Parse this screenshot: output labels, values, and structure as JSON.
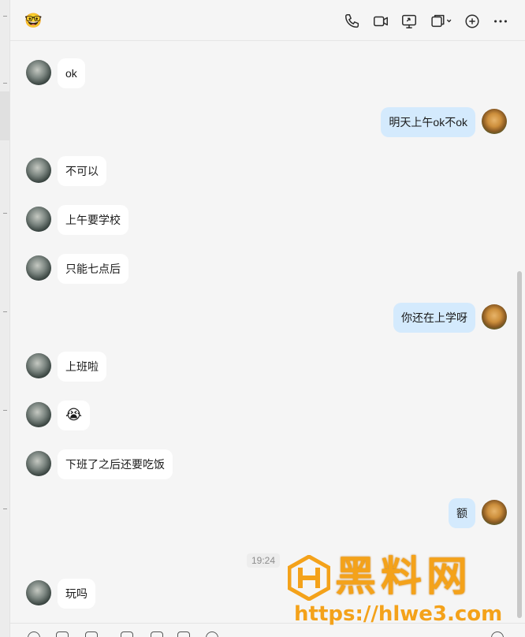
{
  "header": {
    "contact_emoji": "🤓",
    "icons": [
      "phone-icon",
      "video-call-icon",
      "screen-share-icon",
      "window-options-icon",
      "add-icon",
      "more-icon"
    ]
  },
  "messages": [
    {
      "side": "left",
      "text": "ok"
    },
    {
      "side": "right",
      "text": "明天上午ok不ok"
    },
    {
      "side": "left",
      "text": "不可以"
    },
    {
      "side": "left",
      "text": "上午要学校"
    },
    {
      "side": "left",
      "text": "只能七点后"
    },
    {
      "side": "right",
      "text": "你还在上学呀"
    },
    {
      "side": "left",
      "text": "上班啦"
    },
    {
      "side": "left",
      "text": "😭"
    },
    {
      "side": "left",
      "text": "下班了之后还要吃饭"
    },
    {
      "side": "right",
      "text": "额"
    },
    {
      "side": "left",
      "text": "玩吗"
    }
  ],
  "timestamp": "19:24",
  "watermark": {
    "title": "黑料网",
    "url": "https://hlwe3.com"
  },
  "colors": {
    "background": "#f5f5f5",
    "left_bubble": "#ffffff",
    "right_bubble": "#d4eafd",
    "watermark": "#f4a21a"
  }
}
